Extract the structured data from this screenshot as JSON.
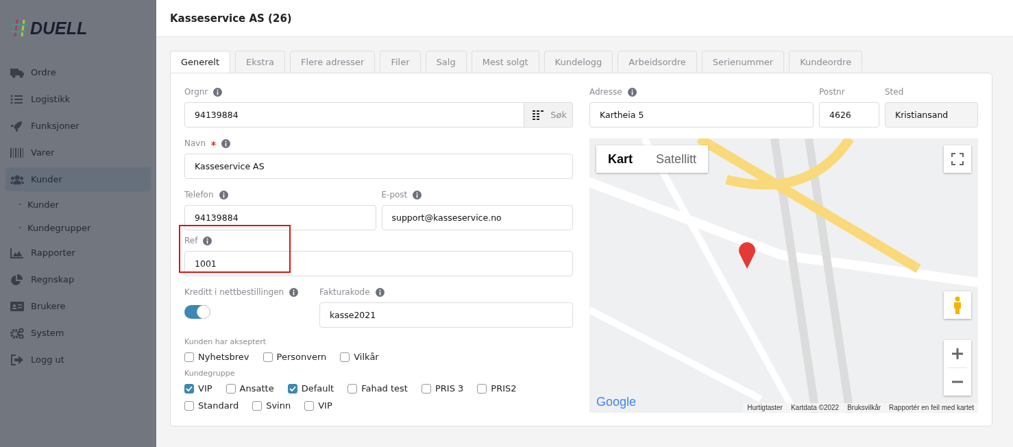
{
  "sidebar": {
    "logo": "DUELL",
    "items": [
      {
        "label": "Ordre",
        "selected": false
      },
      {
        "label": "Logistikk",
        "selected": false
      },
      {
        "label": "Funksjoner",
        "selected": false
      },
      {
        "label": "Varer",
        "selected": false
      },
      {
        "label": "Kunder",
        "selected": true,
        "children": [
          {
            "label": "Kunder"
          },
          {
            "label": "Kundegrupper"
          }
        ]
      },
      {
        "label": "Rapporter",
        "selected": false
      },
      {
        "label": "Regnskap",
        "selected": false
      },
      {
        "label": "Brukere",
        "selected": false
      },
      {
        "label": "System",
        "selected": false
      },
      {
        "label": "Logg ut",
        "selected": false
      }
    ]
  },
  "page": {
    "title": "Kasseservice AS (26)"
  },
  "tabs": [
    {
      "label": "Generelt",
      "selected": true
    },
    {
      "label": "Ekstra",
      "selected": false
    },
    {
      "label": "Flere adresser",
      "selected": false
    },
    {
      "label": "Filer",
      "selected": false
    },
    {
      "label": "Salg",
      "selected": false
    },
    {
      "label": "Mest solgt",
      "selected": false
    },
    {
      "label": "Kundelogg",
      "selected": false
    },
    {
      "label": "Arbeidsordre",
      "selected": false
    },
    {
      "label": "Serienummer",
      "selected": false
    },
    {
      "label": "Kundeordre",
      "selected": false
    }
  ],
  "form": {
    "orgnr": {
      "label": "Orgnr",
      "info": true,
      "value": "94139884",
      "button": "Søk"
    },
    "navn": {
      "label": "Navn",
      "required": true,
      "info": true,
      "value": "Kasseservice AS"
    },
    "telefon": {
      "label": "Telefon",
      "info": true,
      "value": "94139884"
    },
    "epost": {
      "label": "E-post",
      "info": true,
      "value": "support@kasseservice.no"
    },
    "ref": {
      "label": "Ref",
      "info": true,
      "value": "1001",
      "highlighted": true
    },
    "kreditt": {
      "label": "Kreditt i nettbestillingen",
      "info": true,
      "on": true
    },
    "fakturakode": {
      "label": "Fakturakode",
      "info": true,
      "value": "kasse2021"
    },
    "accepted": {
      "label": "Kunden har akseptert",
      "options": [
        {
          "label": "Nyhetsbrev",
          "checked": false
        },
        {
          "label": "Personvern",
          "checked": false
        },
        {
          "label": "Vilkår",
          "checked": false
        }
      ]
    },
    "customer_groups": {
      "label": "Kundegruppe",
      "options": [
        {
          "label": "VIP",
          "checked": true
        },
        {
          "label": "Ansatte",
          "checked": false
        },
        {
          "label": "Default",
          "checked": true
        },
        {
          "label": "Fahad test",
          "checked": false
        },
        {
          "label": "PRIS 3",
          "checked": false
        },
        {
          "label": "PRIS2",
          "checked": false
        },
        {
          "label": "Standard",
          "checked": false
        },
        {
          "label": "Svinn",
          "checked": false
        },
        {
          "label": "VIP",
          "checked": false
        }
      ]
    },
    "adresse": {
      "label": "Adresse",
      "info": true,
      "value": "Kartheia 5"
    },
    "postnr": {
      "label": "Postnr",
      "info": false,
      "value": "4626"
    },
    "sted": {
      "label": "Sted",
      "info": false,
      "value": "Kristiansand",
      "disabled": true
    }
  },
  "map": {
    "type_tabs": [
      {
        "label": "Kart",
        "selected": true
      },
      {
        "label": "Satellitt",
        "selected": false
      }
    ],
    "logo": "Google",
    "footer_links": [
      "Hurtigtaster",
      "Kartdata ©2022",
      "Bruksvilkår",
      "Rapportér en feil med kartet"
    ]
  }
}
